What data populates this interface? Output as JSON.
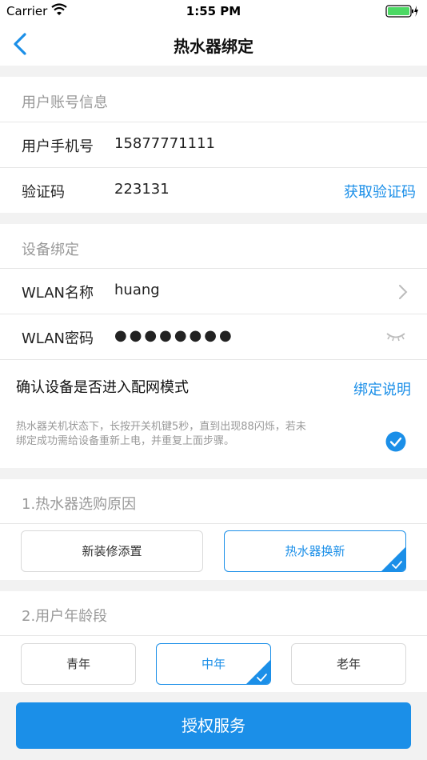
{
  "status_bar": {
    "carrier": "Carrier",
    "time": "1:55 PM"
  },
  "nav": {
    "title": "热水器绑定"
  },
  "account": {
    "section_title": "用户账号信息",
    "phone_label": "用户手机号",
    "phone_value": "15877771111",
    "code_label": "验证码",
    "code_value": "223131",
    "get_code": "获取验证码"
  },
  "device": {
    "section_title": "设备绑定",
    "wlan_name_label": "WLAN名称",
    "wlan_name_value": "huang",
    "wlan_pwd_label": "WLAN密码",
    "wlan_pwd_value": "●●●●●●●●"
  },
  "confirm": {
    "title": "确认设备是否进入配网模式",
    "help_link": "绑定说明",
    "desc_line1": "热水器关机状态下，长按开关机键5秒，直到出现88闪烁，若未",
    "desc_line2": "绑定成功需给设备重新上电，并重复上面步骤。"
  },
  "reason": {
    "section_title": "1.热水器选购原因",
    "option_new": "新装修添置",
    "option_replace": "热水器换新",
    "selected": "热水器换新"
  },
  "age": {
    "section_title": "2.用户年龄段",
    "option_young": "青年",
    "option_middle": "中年",
    "option_old": "老年",
    "selected": "中年"
  },
  "submit_label": "授权服务",
  "colors": {
    "accent": "#1b8fe8",
    "background": "#f2f2f2",
    "battery": "#4cd964"
  }
}
